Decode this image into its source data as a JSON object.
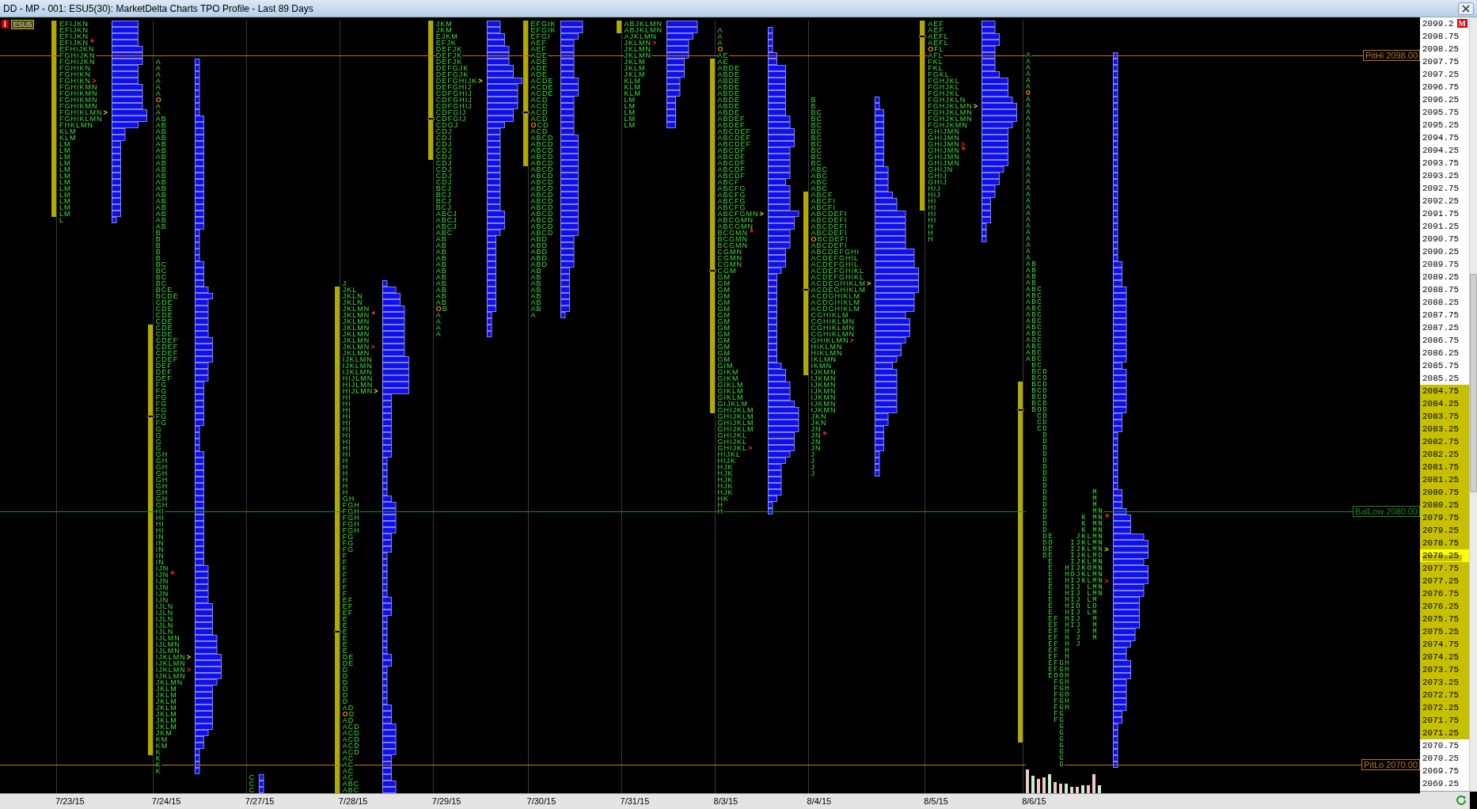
{
  "window": {
    "title": "DD - MP - 001: ESU5(30): MarketDelta Charts TPO Profile - Last 89 Days"
  },
  "chart": {
    "info": "i",
    "symbol": "ESU5"
  },
  "ref_lines": [
    {
      "label": "PitHi 2098.00",
      "color": "#b8781c"
    },
    {
      "label": "BalLow 2080.00",
      "color": "#1f8c1f"
    },
    {
      "label": "PitLo 2070.00",
      "color": "#b8781c"
    }
  ],
  "profiles": [
    {
      "date": "7/23/15",
      "kind": "packed",
      "value_area": true,
      "rows": [
        "EFIJKN",
        "EFIJKN",
        "EFIJKN",
        {
          "text": "EFIJKN",
          "suffix": "*",
          "kind": "star"
        },
        "EFHIJKN",
        "FGHIJKN",
        "FGHIJKN",
        "FGHIKN",
        "FGHIKN",
        {
          "text": "FGHIKN",
          "suffix": ">",
          "kind": "red-arrow"
        },
        "FGHIKMN",
        "FGHIKMN",
        "FGHIKMN",
        "FGHIKMN",
        {
          "text": "FGHIKLMN",
          "suffix": ">",
          "kind": "yellow-arrow"
        },
        "FGHIKLMN",
        "FHKLMN",
        "KLM",
        "KLM",
        "LM",
        "LM",
        "LM",
        "LM",
        "LM",
        "LM",
        "LM",
        "LM",
        "LM",
        "LM",
        "LM",
        "LM",
        "L"
      ]
    },
    {
      "date": "7/24/15",
      "kind": "packed",
      "value_area": true,
      "poc": true,
      "rows": [
        "A",
        "A",
        "A",
        "A",
        "A",
        "A",
        {
          "text": "O",
          "kind": "open"
        },
        "A",
        "A",
        "AB",
        "AB",
        "AB",
        "AB",
        "AB",
        "AB",
        "AB",
        "AB",
        "AB",
        "AB",
        "AB",
        "AB",
        "AB",
        "AB",
        "AB",
        "AB",
        "AB",
        "AB",
        "B",
        "B",
        "B",
        "B",
        "B",
        "BC",
        "BC",
        "BC",
        "BC",
        "BCE",
        "BCDE",
        "CDE",
        "CDE",
        "CDE",
        "CDE",
        "CDE",
        "CDE",
        "CDEF",
        "CDEF",
        "CDEF",
        "CDEF",
        "DEF",
        "DEF",
        "DEF",
        "FG",
        "FG",
        "FG",
        "FG",
        "FG",
        "FG",
        "FG",
        "G",
        "G",
        "G",
        "G",
        "GH",
        "GH",
        "GH",
        "GH",
        "GH",
        "GH",
        "GH",
        "GH",
        "GH",
        "HI",
        "HI",
        "HI",
        "HI",
        "IN",
        "IN",
        "IN",
        "IN",
        "IN",
        "IJN",
        {
          "text": "IJN",
          "suffix": "*",
          "kind": "star"
        },
        "IJN",
        "IJN",
        "IJN",
        "IJN",
        "IJLN",
        "IJLN",
        "IJLN",
        "IJLN",
        "IJLN",
        "IJLMN",
        "IJLMN",
        "IJLMN",
        {
          "text": "IJKLMN",
          "suffix": ">",
          "kind": "yellow-arrow"
        },
        "IJKLMN",
        {
          "text": "IJKLMN",
          "suffix": ">",
          "kind": "red-arrow"
        },
        "IJKLMN",
        "JKLMN",
        "JKLM",
        "JKLM",
        "JKLM",
        "JKLM",
        "JKLM",
        "JKLM",
        "JKLM",
        "JKM",
        "KM",
        "KM",
        "K",
        "K",
        "K",
        "K"
      ]
    },
    {
      "date": "7/27/15",
      "kind": "packed",
      "rows": [
        "C",
        "C",
        "C"
      ]
    },
    {
      "date": "7/28/15",
      "kind": "packed",
      "value_area": true,
      "poc": true,
      "rows": [
        "J",
        "JKL",
        "JKLN",
        "JKLN",
        "JKLMN",
        {
          "text": "JKLMN",
          "suffix": "*",
          "kind": "star"
        },
        "JKLMN",
        "JKLMN",
        "JKLMN",
        "JKLMN",
        {
          "text": "JKLMN",
          "suffix": ">",
          "kind": "red-arrow"
        },
        "JKLMN",
        "IJKLMN",
        "IJKLMN",
        "IJKLMN",
        "HIJLMN",
        "HIJLMN",
        {
          "text": "HIJLMN",
          "suffix": ">",
          "kind": "yellow-arrow"
        },
        "HI",
        "HI",
        "HI",
        "HI",
        "HI",
        "HI",
        "HI",
        "HI",
        "HI",
        "HI",
        "H",
        "H",
        "H",
        "H",
        "H",
        "H",
        "GH",
        "FGH",
        "FGH",
        "FGH",
        "FGH",
        "FGH",
        "FG",
        "FG",
        "FG",
        "F",
        "F",
        "F",
        "F",
        "F",
        "F",
        "F",
        "EF",
        "EF",
        "EF",
        "E",
        "E",
        "E",
        "E",
        "E",
        "E",
        "DE",
        "DE",
        "D",
        "D",
        "D",
        "D",
        "D",
        "D",
        "AD",
        {
          "text": "OD",
          "kind": "open"
        },
        "AD",
        "ACD",
        "ACD",
        "ACD",
        "ACD",
        "ACD",
        "AC",
        "AC",
        "AC",
        "AC",
        "ABC",
        "ABC"
      ]
    },
    {
      "date": "7/29/15",
      "kind": "packed",
      "value_area": true,
      "poc": true,
      "rows": [
        "JKM",
        "JKM",
        "EJKM",
        "EFJK",
        "DEFJK",
        "DEFJK",
        "DEFJK",
        "DEFGJK",
        "DEFGJK",
        {
          "text": "DEFGHIJK",
          "suffix": ">",
          "kind": "yellow-arrow"
        },
        "DEFGHIJ",
        "CDFGHIJ",
        "CDFGHIJ",
        "CDFGHIJ",
        "CDFGIJ",
        "CDFGIJ",
        "CDGJ",
        "CDJ",
        "CDJ",
        "CDJ",
        "CDJ",
        "CDJ",
        "CDJ",
        "CDJ",
        "CDJ",
        "CDJ",
        "BCJ",
        "BCJ",
        "BCJ",
        "BCJ",
        "ABCJ",
        "ABCJ",
        "ABCJ",
        "ABC",
        "AB",
        "AB",
        "AB",
        "AB",
        "AB",
        "AB",
        "AB",
        "AB",
        "AB",
        "AB",
        "AB",
        {
          "text": "OB",
          "kind": "open"
        },
        "A",
        "A",
        "A",
        "A"
      ]
    },
    {
      "date": "7/30/15",
      "kind": "packed",
      "value_area": true,
      "poc": true,
      "rows": [
        "EFGIK",
        "EFGIK",
        "EFGI",
        "AEF",
        "AEF",
        "ADE",
        "ADE",
        "ADE",
        "ADE",
        "ACDE",
        "ACDE",
        "ACDE",
        "ACD",
        "ACD",
        "ACD",
        "ACD",
        {
          "text": "OCD",
          "kind": "open"
        },
        "ACD",
        "ABCD",
        "ABCD",
        "ABCD",
        "ABCD",
        "ABCD",
        "ABCD",
        "ABCD",
        "ABCD",
        "ABCD",
        "ABCD",
        "ABCD",
        "ABCD",
        "ABCD",
        "ABCD",
        "ABCD",
        "ABCD",
        "ABD",
        "ABD",
        "ABD",
        "ABD",
        "ABD",
        "AB",
        "AB",
        "AB",
        "AB",
        "AB",
        "AB",
        "AB",
        "A"
      ]
    },
    {
      "date": "7/31/15",
      "kind": "packed",
      "value_area": true,
      "rows": [
        "ABJKLMN",
        "ABJKLMN",
        "AJKLMN",
        {
          "text": "JKLMN",
          "suffix": ">",
          "kind": "red-arrow"
        },
        "JKLMN",
        "JKLMN",
        "JKLM",
        "JKLM",
        "JKLM",
        "KLM",
        "KLM",
        "KLM",
        "LM",
        "LM",
        "LM",
        "LM",
        "LM"
      ]
    },
    {
      "date": "8/3/15",
      "kind": "packed",
      "value_area": true,
      "poc": true,
      "rows": [
        "A",
        "A",
        "A",
        {
          "text": "O",
          "kind": "open"
        },
        "AE",
        "AE",
        "ABDE",
        "ABDE",
        "ABDE",
        "ABDE",
        "ABDE",
        "ABDE",
        "ABDE",
        "ABDE",
        "ABDEF",
        "ABDEF",
        "ABCDEF",
        "ABCDEF",
        "ABCDEF",
        "ABCDF",
        "ABCDF",
        "ABCDF",
        "ABCDF",
        "ABCDF",
        "ABCF",
        "ABCFG",
        "ABCFG",
        "ABCFG",
        "ABCFG",
        {
          "text": "ABCFGMN",
          "suffix": ">",
          "kind": "yellow-arrow"
        },
        "ABCGMN",
        "ABCGMN",
        {
          "text": "BCGMN",
          "suffix": "*",
          "kind": "star"
        },
        "BCGMN",
        "BCGMN",
        "CGMN",
        "CGMN",
        "CGMN",
        "CGM",
        "GM",
        "GM",
        "GM",
        "GM",
        "GM",
        "GM",
        "GM",
        "GM",
        "GM",
        "GM",
        "GM",
        "GM",
        "GM",
        "GM",
        "GIM",
        "GIKM",
        "GIKM",
        "GIKLM",
        "GIKLM",
        "GIKLM",
        "GIJKLM",
        "GHIJKLM",
        "GHIJKLM",
        "GHIJKLM",
        "GHIJKLM",
        "GHIJKL",
        "GHIJKL",
        {
          "text": "GHIJKL",
          "suffix": ">",
          "kind": "red-arrow"
        },
        "HIJKL",
        "HIJK",
        "HJK",
        "HJK",
        "HJK",
        "HJK",
        "HJK",
        "HK",
        "H",
        "H"
      ]
    },
    {
      "date": "8/4/15",
      "kind": "packed",
      "value_area": true,
      "poc": true,
      "rows": [
        "B",
        "B",
        "BC",
        "BC",
        "BC",
        "BC",
        "BC",
        "BC",
        "BC",
        "BC",
        "BC",
        "ABC",
        "ABC",
        "ABC",
        "ABC",
        "ABCF",
        "ABCFI",
        "ABCFI",
        "ABCDEFI",
        "ABCDEFI",
        "ABCDEFI",
        "ABCDEFI",
        {
          "text": "OBCDEFI",
          "kind": "open"
        },
        "ABCDEFI",
        "ABCDEFGHI",
        "ACDEFGHIL",
        "ACDEFGHIL",
        "ACDEFGHIKL",
        "ACDEFGHIKL",
        {
          "text": "ACDEGHIKLM",
          "suffix": ">",
          "kind": "yellow-arrow"
        },
        "ACDEGHIKLM",
        "ACDGHIKLM",
        "ACDGHIKLM",
        "ACDGHIKLM",
        "CGHIKLM",
        "CGHIKLMN",
        "CGHIKLMN",
        "CGHIKLMN",
        {
          "text": "GHIKLMN",
          "suffix": ">",
          "kind": "red-arrow"
        },
        "HIKLMN",
        "HIKLMN",
        "IKLMN",
        "IKMN",
        "IJKMN",
        "IJKMN",
        "IJKMN",
        "IJKMN",
        "IJKMN",
        "IJKMN",
        "IJKMN",
        "JKN",
        "JKN",
        "JN",
        {
          "text": "JN",
          "suffix": "*",
          "kind": "star"
        },
        "JN",
        "JN",
        "J",
        "J",
        "J",
        "J"
      ]
    },
    {
      "date": "8/5/15",
      "kind": "packed",
      "value_area": true,
      "poc": true,
      "rows": [
        "AEF",
        "AEF",
        "AEFL",
        "AEFL",
        {
          "text": "OFL",
          "kind": "open"
        },
        "AFL",
        "FKL",
        "FKL",
        "FGKL",
        "FGHJKL",
        "FGHJKL",
        "FGHJKL",
        "FGHJKLN",
        {
          "text": "FGHJKLMN",
          "suffix": ">",
          "kind": "yellow-arrow"
        },
        "FGHJKLMN",
        "FGHJKLMN",
        "FGHJKMN",
        "GHIJMN",
        "GHIJMN",
        {
          "text": "GHIJMN",
          "suffix": ">",
          "kind": "red-arrow"
        },
        {
          "text": "GHIJMN",
          "suffix": "*",
          "kind": "star"
        },
        "GHIJMN",
        "GHIJMN",
        "GHIJN",
        "GHIJ",
        "GHIJ",
        "HIJ",
        "HIJ",
        "HI",
        "HI",
        "HI",
        "HI",
        "H",
        "H",
        "H"
      ]
    },
    {
      "date": "8/6/15",
      "kind": "columns",
      "volume_bars": true,
      "value_area": true,
      "poc": true,
      "rows": [
        "A",
        "A",
        "A",
        "A",
        "A",
        "A",
        {
          "text": "O",
          "kind": "open"
        },
        "A",
        "A",
        "A",
        "A",
        "A",
        "A",
        "A",
        "A",
        "A",
        "A",
        "A",
        "A",
        "A",
        "A",
        "A",
        "A",
        "A",
        "A",
        "A",
        "A",
        "A",
        "A",
        "A",
        "A",
        "A",
        "A",
        "AB",
        "AB",
        "AB",
        "AB",
        "ABC",
        "ABC",
        "ABC",
        "ABC",
        "ABC",
        "ABC",
        "ABC",
        "ABC",
        "AOC",
        "ABC",
        "ABC",
        "ABC",
        " BC",
        " BCD",
        " BCO",
        " BCD",
        " BCD",
        " BCD",
        " BCD",
        " BOD",
        "  CD",
        "  CD",
        "  CD",
        "   D",
        "   D",
        "   D",
        "   D",
        "   D",
        "   D",
        "   D",
        "   D",
        "   D",
        "   D        M",
        "   D        M",
        "   D        M",
        "   D        MN",
        {
          "text": "   D      K MN",
          "suffix": "*",
          "kind": "star"
        },
        "   D      K MN",
        "   D      K MN",
        "   DE    JKLMN",
        "   DO   IJKLMN",
        {
          "text": "   DE   IJKLMN",
          "suffix": ">",
          "kind": "yellow-arrow"
        },
        "   DE   IJKLMO",
        "    E   IJKLMN",
        "    E  HIJKOMN",
        "    E  HOJKLMN",
        {
          "text": "    E  HIJKLMN",
          "suffix": ">",
          "kind": "red-arrow"
        },
        "    E  HIJ LMN",
        "    E  HIJ LMN",
        "    E  HIJ LM",
        "    E  HIO LO",
        "    E  HIJ LM",
        "    EF HIJ  M",
        "    EF HIJ  M",
        "    EF H J  M",
        "    EF H J  M",
        "    EF H J",
        "    EF H",
        "    EF H",
        "    EFGH",
        "    EFGH",
        "    EOOH",
        "     FGH",
        "     FGH",
        "     FGO",
        "     FGH",
        "     FGH",
        "     FG",
        "     FG",
        "      G",
        "      G",
        "      G",
        "      G",
        "      G",
        "      G",
        "      G"
      ]
    }
  ],
  "axis": {
    "flag": "M",
    "labels": [
      {
        "text": "2099.2",
        "value_area": false,
        "current": false
      },
      {
        "text": "2098.75",
        "value_area": false,
        "current": false
      },
      {
        "text": "2098.25",
        "value_area": false,
        "current": false
      },
      {
        "text": "2097.75",
        "value_area": false,
        "current": false
      },
      {
        "text": "2097.25",
        "value_area": false,
        "current": false
      },
      {
        "text": "2096.75",
        "value_area": false,
        "current": false
      },
      {
        "text": "2096.25",
        "value_area": false,
        "current": false
      },
      {
        "text": "2095.75",
        "value_area": false,
        "current": false
      },
      {
        "text": "2095.25",
        "value_area": false,
        "current": false
      },
      {
        "text": "2094.75",
        "value_area": false,
        "current": false
      },
      {
        "text": "2094.25",
        "value_area": false,
        "current": false
      },
      {
        "text": "2093.75",
        "value_area": false,
        "current": false
      },
      {
        "text": "2093.25",
        "value_area": false,
        "current": false
      },
      {
        "text": "2092.75",
        "value_area": false,
        "current": false
      },
      {
        "text": "2092.25",
        "value_area": false,
        "current": false
      },
      {
        "text": "2091.75",
        "value_area": false,
        "current": false
      },
      {
        "text": "2091.25",
        "value_area": false,
        "current": false
      },
      {
        "text": "2090.75",
        "value_area": false,
        "current": false
      },
      {
        "text": "2090.25",
        "value_area": false,
        "current": false
      },
      {
        "text": "2089.75",
        "value_area": false,
        "current": false
      },
      {
        "text": "2089.25",
        "value_area": false,
        "current": false
      },
      {
        "text": "2088.75",
        "value_area": false,
        "current": false
      },
      {
        "text": "2088.25",
        "value_area": false,
        "current": false
      },
      {
        "text": "2087.75",
        "value_area": false,
        "current": false
      },
      {
        "text": "2087.25",
        "value_area": false,
        "current": false
      },
      {
        "text": "2086.75",
        "value_area": false,
        "current": false
      },
      {
        "text": "2086.25",
        "value_area": false,
        "current": false
      },
      {
        "text": "2085.75",
        "value_area": false,
        "current": false
      },
      {
        "text": "2085.25",
        "value_area": false,
        "current": false
      },
      {
        "text": "2084.75",
        "value_area": true,
        "current": false
      },
      {
        "text": "2084.25",
        "value_area": true,
        "current": false
      },
      {
        "text": "2083.75",
        "value_area": true,
        "current": false
      },
      {
        "text": "2083.25",
        "value_area": true,
        "current": false
      },
      {
        "text": "2082.75",
        "value_area": true,
        "current": false
      },
      {
        "text": "2082.25",
        "value_area": true,
        "current": false
      },
      {
        "text": "2081.75",
        "value_area": true,
        "current": false
      },
      {
        "text": "2081.25",
        "value_area": true,
        "current": false
      },
      {
        "text": "2080.75",
        "value_area": true,
        "current": false
      },
      {
        "text": "2080.25",
        "value_area": true,
        "current": false
      },
      {
        "text": "2079.75",
        "value_area": true,
        "current": false
      },
      {
        "text": "2079.25",
        "value_area": true,
        "current": false
      },
      {
        "text": "2078.75",
        "value_area": true,
        "current": false
      },
      {
        "text": "2078.25",
        "value_area": true,
        "current": true
      },
      {
        "text": "2077.75",
        "value_area": true,
        "current": false
      },
      {
        "text": "2077.25",
        "value_area": true,
        "current": false
      },
      {
        "text": "2076.75",
        "value_area": true,
        "current": false
      },
      {
        "text": "2076.25",
        "value_area": true,
        "current": false
      },
      {
        "text": "2075.75",
        "value_area": true,
        "current": false
      },
      {
        "text": "2075.25",
        "value_area": true,
        "current": false
      },
      {
        "text": "2074.75",
        "value_area": true,
        "current": false
      },
      {
        "text": "2074.25",
        "value_area": true,
        "current": false
      },
      {
        "text": "2073.75",
        "value_area": true,
        "current": false
      },
      {
        "text": "2073.25",
        "value_area": true,
        "current": false
      },
      {
        "text": "2072.75",
        "value_area": true,
        "current": false
      },
      {
        "text": "2072.25",
        "value_area": true,
        "current": false
      },
      {
        "text": "2071.75",
        "value_area": true,
        "current": false
      },
      {
        "text": "2071.25",
        "value_area": true,
        "current": false
      },
      {
        "text": "2070.75",
        "value_area": false,
        "current": false
      },
      {
        "text": "2070.25",
        "value_area": false,
        "current": false
      },
      {
        "text": "2069.75",
        "value_area": false,
        "current": false
      },
      {
        "text": "2069.25",
        "value_area": false,
        "current": false
      }
    ]
  }
}
